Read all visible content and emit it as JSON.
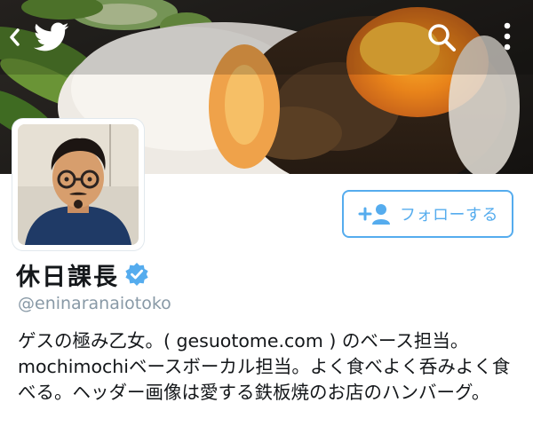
{
  "header": {
    "back_icon": "chevron-left-icon",
    "logo_icon": "twitter-bird-icon",
    "search_icon": "search-icon",
    "menu_icon": "more-vertical-icon"
  },
  "profile": {
    "display_name": "休日課長",
    "verified": true,
    "handle": "@eninaranaiotoko",
    "bio": "ゲスの極み乙女。( gesuotome.com ) のベース担当。mochimochiベースボーカル担当。よく食べよく呑みよく食べる。ヘッダー画像は愛する鉄板焼のお店のハンバーグ。"
  },
  "follow_button": {
    "label": "フォローする",
    "icon": "add-user-icon"
  },
  "colors": {
    "accent": "#55acee",
    "name_text": "#14171a",
    "handle_text": "#8899a6",
    "verified_badge": "#55acee"
  }
}
